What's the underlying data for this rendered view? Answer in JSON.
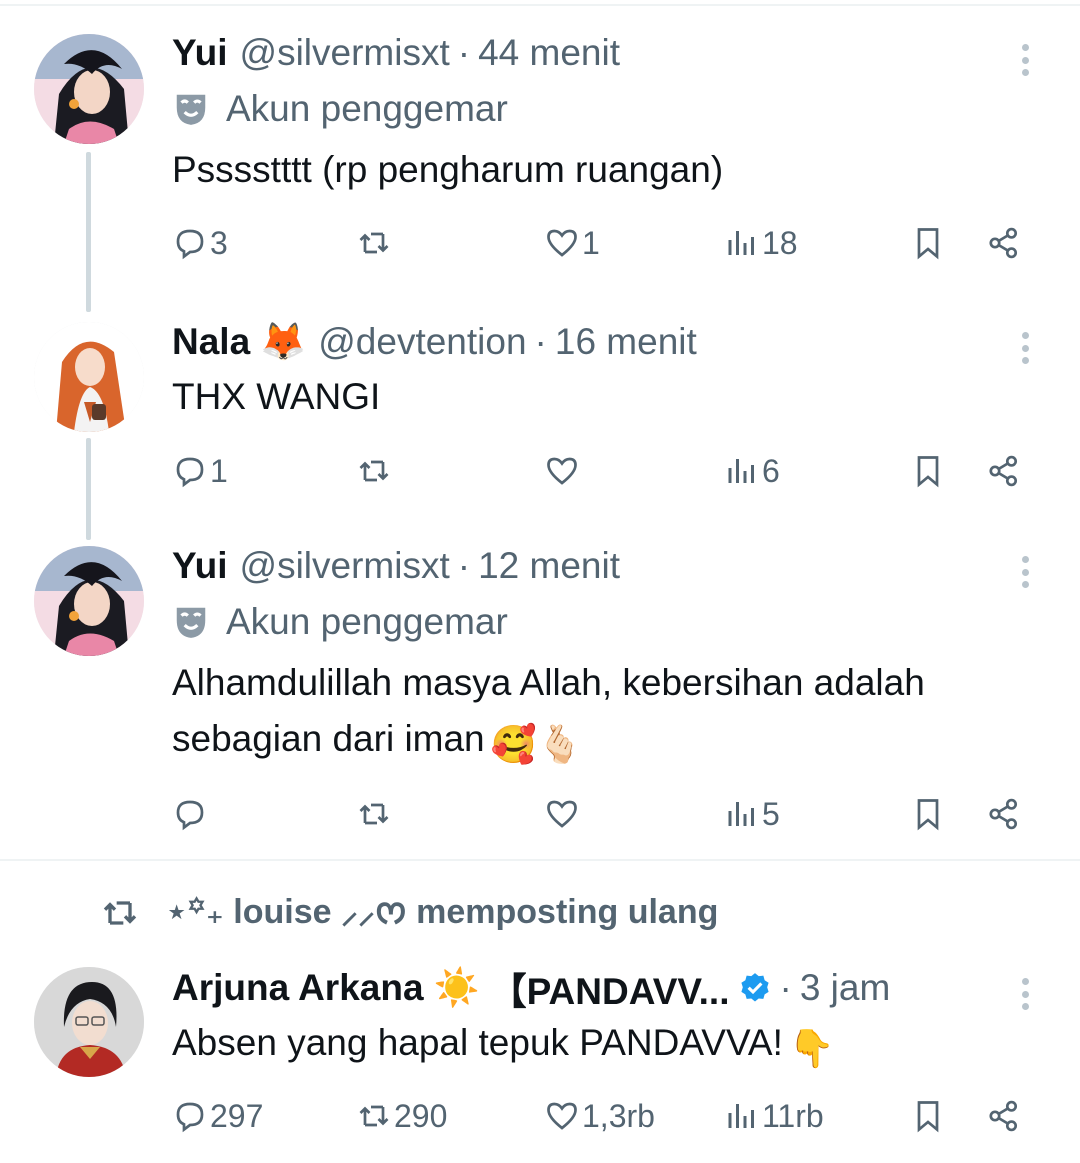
{
  "tweets": [
    {
      "name": "Yui",
      "handle": "@silvermisxt",
      "separator": "·",
      "time": "44 menit",
      "fan_label": "Akun penggemar",
      "text": "Psssstttt (rp pengharum ruangan)",
      "replies": "3",
      "reposts": "",
      "likes": "1",
      "views": "18"
    },
    {
      "name": "Nala",
      "name_emoji": "🦊",
      "handle": "@devtention",
      "separator": "·",
      "time": "16 menit",
      "text": "THX WANGI",
      "replies": "1",
      "reposts": "",
      "likes": "",
      "views": "6"
    },
    {
      "name": "Yui",
      "handle": "@silvermisxt",
      "separator": "·",
      "time": "12 menit",
      "fan_label": "Akun penggemar",
      "text_line1": "Alhamdulillah masya Allah, kebersihan adalah",
      "text_line2": "sebagian dari iman",
      "text_emojis": "🥰🫰🏻",
      "replies": "",
      "reposts": "",
      "likes": "",
      "views": "5"
    }
  ],
  "repost_banner": {
    "text": "⋆꙳₊ louise ⸝⸝ᰔ memposting ulang"
  },
  "repost_tweet": {
    "name": "Arjuna Arkana",
    "name_emoji": "☀️",
    "name_suffix": "【PANDAVV...",
    "separator": "·",
    "time": "3 jam",
    "text": "Absen yang hapal tepuk PANDAVVA!",
    "text_emoji": "👇",
    "replies": "297",
    "reposts": "290",
    "likes": "1,3rb",
    "views": "11rb"
  },
  "colors": {
    "text_primary": "#0f1419",
    "text_secondary": "#536471",
    "divider": "#eff3f4",
    "thread_line": "#cfd9de",
    "verified": "#1d9bf0"
  },
  "icons": [
    "reply-icon",
    "repost-icon",
    "like-icon",
    "views-icon",
    "bookmark-icon",
    "share-icon",
    "more-icon",
    "fan-mask-icon",
    "verified-badge-icon"
  ]
}
